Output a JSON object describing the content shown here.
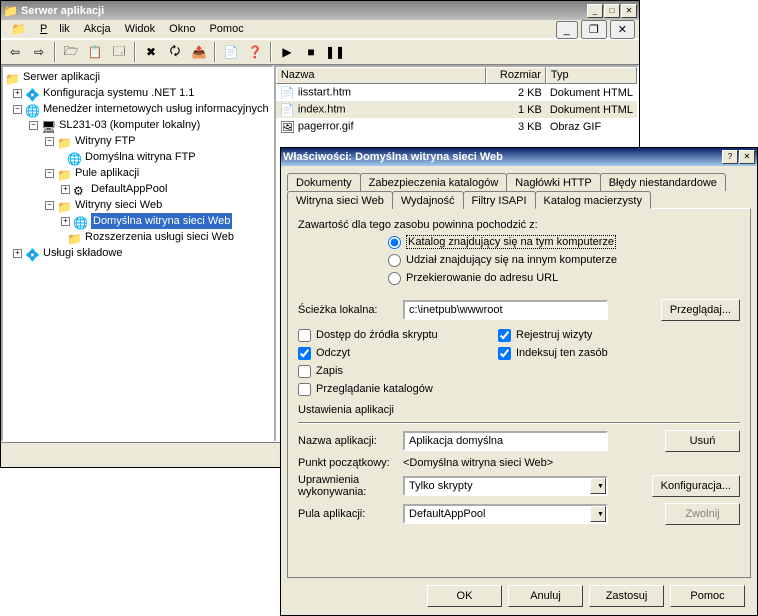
{
  "mainWindow": {
    "title": "Serwer aplikacji",
    "menu": {
      "plik": "Plik",
      "akcja": "Akcja",
      "widok": "Widok",
      "okno": "Okno",
      "pomoc": "Pomoc"
    }
  },
  "tree": {
    "root": "Serwer aplikacji",
    "netcfg": "Konfiguracja systemu .NET 1.1",
    "iis": "Menedżer internetowych usług informacyjnych",
    "server": "SL231-03 (komputer lokalny)",
    "ftpSites": "Witryny FTP",
    "ftpDefault": "Domyślna witryna FTP",
    "appPools": "Pule aplikacji",
    "defAppPool": "DefaultAppPool",
    "webSites": "Witryny sieci Web",
    "defWebSite": "Domyślna witryna sieci Web",
    "webExt": "Rozszerzenia usługi sieci Web",
    "compServices": "Usługi składowe"
  },
  "list": {
    "col_name": "Nazwa",
    "col_size": "Rozmiar",
    "col_type": "Typ",
    "r0": {
      "name": "iisstart.htm",
      "size": "2 KB",
      "type": "Dokument HTML"
    },
    "r1": {
      "name": "index.htm",
      "size": "1 KB",
      "type": "Dokument HTML"
    },
    "r2": {
      "name": "pagerror.gif",
      "size": "3 KB",
      "type": "Obraz GIF"
    }
  },
  "dialog": {
    "title": "Właściwości: Domyślna witryna sieci Web",
    "help_btn": "?",
    "close_btn": "✕",
    "tabs_row1": {
      "docs": "Dokumenty",
      "dirsec": "Zabezpieczenia katalogów",
      "http": "Nagłówki HTTP",
      "errors": "Błędy niestandardowe"
    },
    "tabs_row2": {
      "website": "Witryna sieci Web",
      "perf": "Wydajność",
      "isapi": "Filtry ISAPI",
      "homedir": "Katalog macierzysty"
    },
    "content_label": "Zawartość dla tego zasobu powinna pochodzić z:",
    "radio1": "Katalog znajdujący się na tym komputerze",
    "radio2": "Udział znajdujący się na innym komputerze",
    "radio3": "Przekierowanie do adresu URL",
    "path_label": "Ścieżka lokalna:",
    "path_value": "c:\\inetpub\\wwwroot",
    "browse_btn": "Przeglądaj...",
    "chk_script": "Dostęp do źródła skryptu",
    "chk_read": "Odczyt",
    "chk_write": "Zapis",
    "chk_browse": "Przeglądanie katalogów",
    "chk_log": "Rejestruj wizyty",
    "chk_index": "Indeksuj ten zasób",
    "app_settings": "Ustawienia aplikacji",
    "app_name_label": "Nazwa aplikacji:",
    "app_name_value": "Aplikacja domyślna",
    "delete_btn": "Usuń",
    "start_label": "Punkt początkowy:",
    "start_value": "<Domyślna witryna sieci Web>",
    "config_btn": "Konfiguracja...",
    "exec_label": "Uprawnienia wykonywania:",
    "exec_value": "Tylko skrypty",
    "pool_label": "Pula aplikacji:",
    "pool_value": "DefaultAppPool",
    "release_btn": "Zwolnij",
    "ok": "OK",
    "cancel": "Anuluj",
    "apply": "Zastosuj",
    "help": "Pomoc"
  }
}
